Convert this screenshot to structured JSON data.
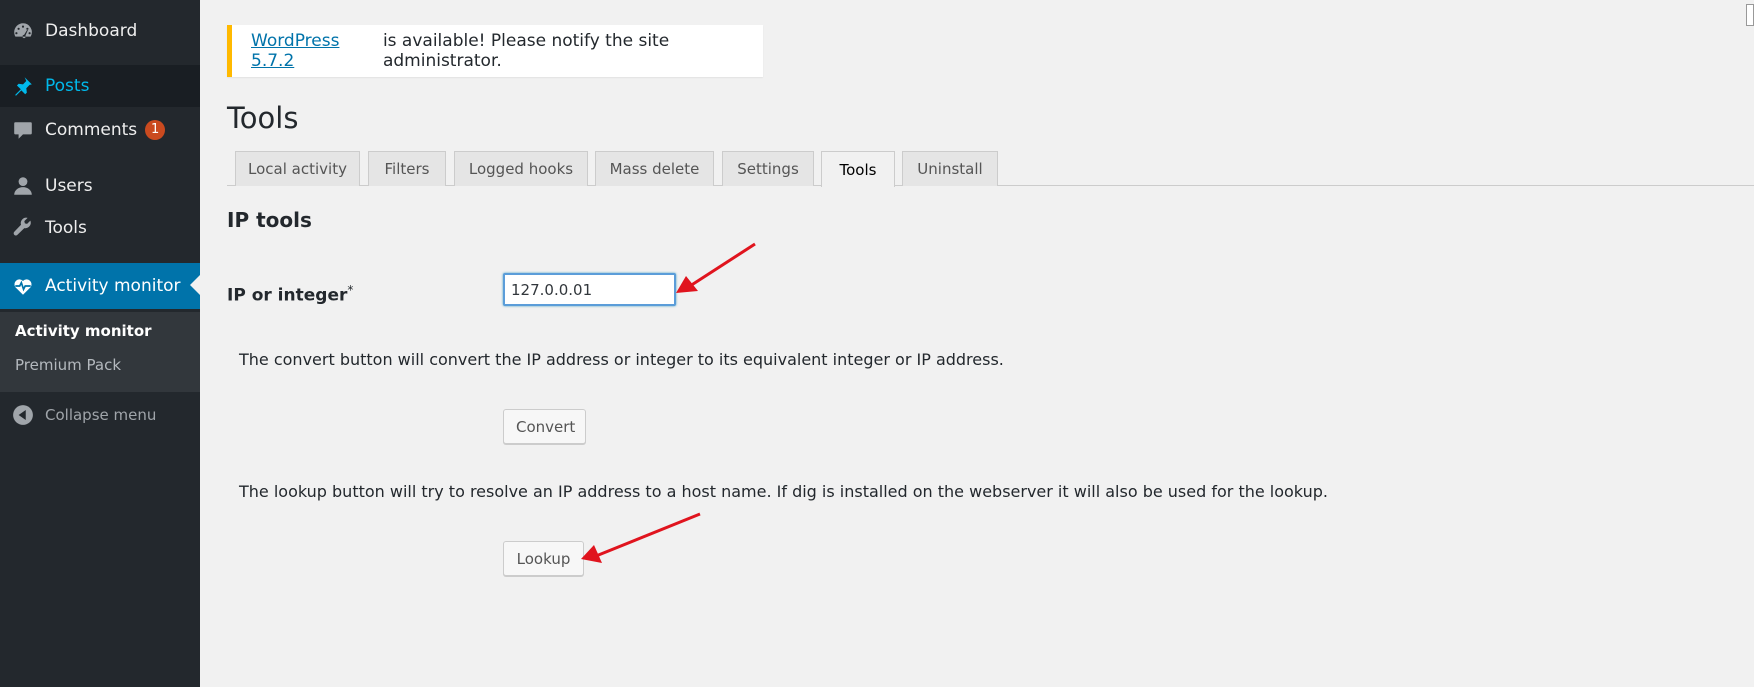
{
  "sidebar": {
    "items": [
      {
        "label": "Dashboard",
        "icon": "dashboard-icon"
      },
      {
        "label": "Posts",
        "icon": "pin-icon"
      },
      {
        "label": "Comments",
        "icon": "comment-icon",
        "badge": "1"
      },
      {
        "label": "Users",
        "icon": "user-icon"
      },
      {
        "label": "Tools",
        "icon": "wrench-icon"
      },
      {
        "label": "Activity monitor",
        "icon": "heart-pulse-icon"
      }
    ],
    "submenu": [
      {
        "label": "Activity monitor"
      },
      {
        "label": "Premium Pack"
      }
    ],
    "collapse_label": "Collapse menu"
  },
  "notice": {
    "link_text": "WordPress 5.7.2",
    "text": "is available! Please notify the site administrator."
  },
  "page": {
    "title": "Tools",
    "tabs": [
      "Local activity",
      "Filters",
      "Logged hooks",
      "Mass delete",
      "Settings",
      "Tools",
      "Uninstall"
    ],
    "active_tab": "Tools",
    "section_title": "IP tools",
    "ip_label": "IP or integer",
    "ip_required_mark": "*",
    "ip_value": "127.0.0.01",
    "convert_description": "The convert button will convert the IP address or integer to its equivalent integer or IP address.",
    "convert_label": "Convert",
    "lookup_description": "The lookup button will try to resolve an IP address to a host name. If dig is installed on the webserver it will also be used for the lookup.",
    "lookup_label": "Lookup"
  },
  "colors": {
    "sidebar_bg": "#23282d",
    "active_bg": "#0073aa",
    "posts_text": "#00b9eb",
    "badge": "#ca4a1f",
    "notice_border": "#ffb900",
    "annotation_arrow": "#e0141e"
  }
}
